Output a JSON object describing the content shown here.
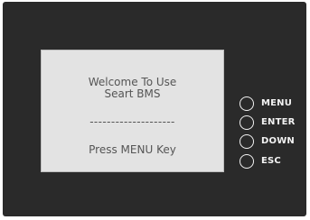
{
  "display": {
    "line1": "Welcome To Use",
    "line2": "Seart BMS",
    "separator": "--------------------",
    "line3": "Press MENU Key"
  },
  "buttons": [
    {
      "label": "MENU",
      "icon": "circle-button-icon"
    },
    {
      "label": "ENTER",
      "icon": "circle-button-icon"
    },
    {
      "label": "DOWN",
      "icon": "circle-button-icon"
    },
    {
      "label": "ESC",
      "icon": "circle-button-icon"
    }
  ],
  "colors": {
    "panel": "#2a2a2a",
    "screen": "#e3e3e3",
    "screen_text": "#555555",
    "button_text": "#f2f2f2"
  }
}
